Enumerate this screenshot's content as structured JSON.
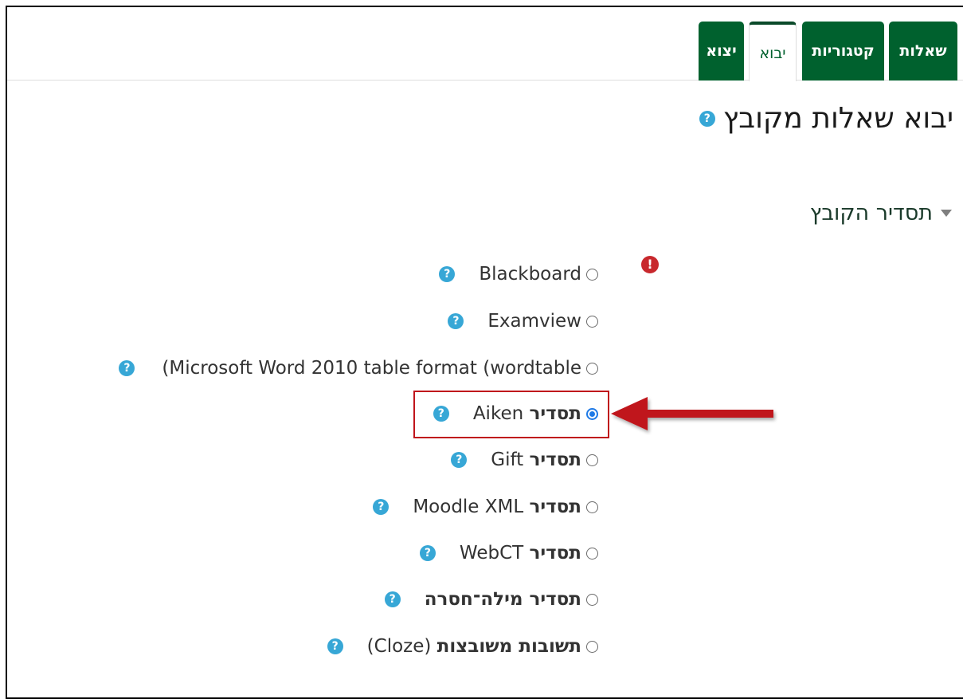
{
  "tabs": [
    {
      "label": "שאלות",
      "active": false
    },
    {
      "label": "קטגוריות",
      "active": false
    },
    {
      "label": "יבוא",
      "active": true
    },
    {
      "label": "יצוא",
      "active": false
    }
  ],
  "page_title": "יבוא שאלות מקובץ",
  "section_header": "תסדיר הקובץ",
  "error_glyph": "!",
  "help_glyph": "?",
  "options": [
    {
      "label": "Blackboard",
      "prefix": "",
      "checked": false
    },
    {
      "label": "Examview",
      "prefix": "",
      "checked": false
    },
    {
      "label": "(Microsoft Word 2010 table format (wordtable",
      "prefix": "",
      "checked": false
    },
    {
      "label": "Aiken",
      "prefix": "תסדיר",
      "checked": true
    },
    {
      "label": "Gift",
      "prefix": "תסדיר",
      "checked": false
    },
    {
      "label": "Moodle XML",
      "prefix": "תסדיר",
      "checked": false
    },
    {
      "label": "WebCT",
      "prefix": "תסדיר",
      "checked": false
    },
    {
      "label": "",
      "prefix": "תסדיר מילה־חסרה",
      "checked": false
    },
    {
      "label": "(Cloze)",
      "prefix": "תשובות משובצות",
      "checked": false
    }
  ],
  "colors": {
    "tab_green": "#00612e",
    "help_blue": "#37a7d6",
    "error_red": "#c8282d",
    "annotation_red": "#c0141c"
  }
}
